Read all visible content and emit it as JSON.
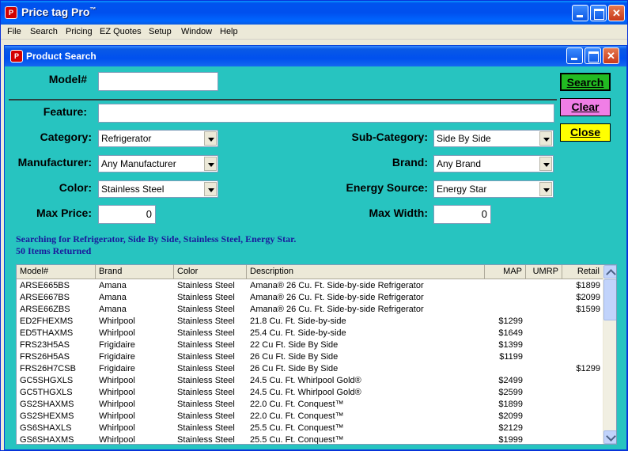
{
  "app": {
    "title": "Price tag Pro",
    "trademark": "™",
    "icon": "price-tag-pro-logo"
  },
  "menu": [
    "File",
    "Search",
    "Pricing",
    "EZ Quotes",
    "Setup",
    "Window",
    "Help"
  ],
  "window": {
    "title": "Product Search"
  },
  "form": {
    "model_label": "Model#",
    "model_value": "",
    "feature_label": "Feature:",
    "feature_value": "",
    "category_label": "Category:",
    "category_value": "Refrigerator",
    "subcategory_label": "Sub-Category:",
    "subcategory_value": "Side By Side",
    "manufacturer_label": "Manufacturer:",
    "manufacturer_value": "Any Manufacturer",
    "brand_label": "Brand:",
    "brand_value": "Any Brand",
    "color_label": "Color:",
    "color_value": "Stainless Steel",
    "energy_label": "Energy Source:",
    "energy_value": "Energy Star",
    "maxprice_label": "Max Price:",
    "maxprice_value": "0",
    "maxwidth_label": "Max Width:",
    "maxwidth_value": "0"
  },
  "actions": {
    "search": "Search",
    "clear": "Clear",
    "close": "Close"
  },
  "status": {
    "line1": "Searching for Refrigerator, Side By Side, Stainless Steel, Energy Star.",
    "line2": "50 Items Returned"
  },
  "table": {
    "columns": [
      "Model#",
      "Brand",
      "Color",
      "Description",
      "MAP",
      "UMRP",
      "Retail"
    ],
    "rows": [
      [
        "ARSE665BS",
        "Amana",
        "Stainless Steel",
        "Amana® 26 Cu. Ft. Side-by-side Refrigerator",
        "",
        "",
        "$1899"
      ],
      [
        "ARSE667BS",
        "Amana",
        "Stainless Steel",
        "Amana® 26 Cu. Ft. Side-by-side Refrigerator",
        "",
        "",
        "$2099"
      ],
      [
        "ARSE66ZBS",
        "Amana",
        "Stainless Steel",
        "Amana® 26 Cu. Ft. Side-by-side Refrigerator",
        "",
        "",
        "$1599"
      ],
      [
        "ED2FHEXMS",
        "Whirlpool",
        "Stainless Steel",
        "21.8 Cu. Ft. Side-by-side",
        "$1299",
        "",
        ""
      ],
      [
        "ED5THAXMS",
        "Whirlpool",
        "Stainless Steel",
        "25.4 Cu. Ft. Side-by-side",
        "$1649",
        "",
        ""
      ],
      [
        "FRS23H5AS",
        "Frigidaire",
        "Stainless Steel",
        "22 Cu Ft. Side By Side",
        "$1399",
        "",
        ""
      ],
      [
        "FRS26H5AS",
        "Frigidaire",
        "Stainless Steel",
        "26 Cu Ft. Side By Side",
        "$1199",
        "",
        ""
      ],
      [
        "FRS26H7CSB",
        "Frigidaire",
        "Stainless Steel",
        "26 Cu Ft. Side By Side",
        "",
        "",
        "$1299"
      ],
      [
        "GC5SHGXLS",
        "Whirlpool",
        "Stainless Steel",
        "24.5 Cu. Ft. Whirlpool Gold®",
        "$2499",
        "",
        ""
      ],
      [
        "GC5THGXLS",
        "Whirlpool",
        "Stainless Steel",
        "24.5 Cu. Ft. Whirlpool Gold®",
        "$2599",
        "",
        ""
      ],
      [
        "GS2SHAXMS",
        "Whirlpool",
        "Stainless Steel",
        "22.0 Cu. Ft. Conquest™",
        "$1899",
        "",
        ""
      ],
      [
        "GS2SHEXMS",
        "Whirlpool",
        "Stainless Steel",
        "22.0 Cu. Ft. Conquest™",
        "$2099",
        "",
        ""
      ],
      [
        "GS6SHAXLS",
        "Whirlpool",
        "Stainless Steel",
        "25.5 Cu. Ft. Conquest™",
        "$2129",
        "",
        ""
      ],
      [
        "GS6SHAXMS",
        "Whirlpool",
        "Stainless Steel",
        "25.5 Cu. Ft. Conquest™",
        "$1999",
        "",
        ""
      ]
    ]
  },
  "colors": {
    "panel": "#27c4c0",
    "search": "#22bb22",
    "clear": "#f07ee6",
    "close": "#ffff00",
    "status_text": "#1a1a9c"
  }
}
